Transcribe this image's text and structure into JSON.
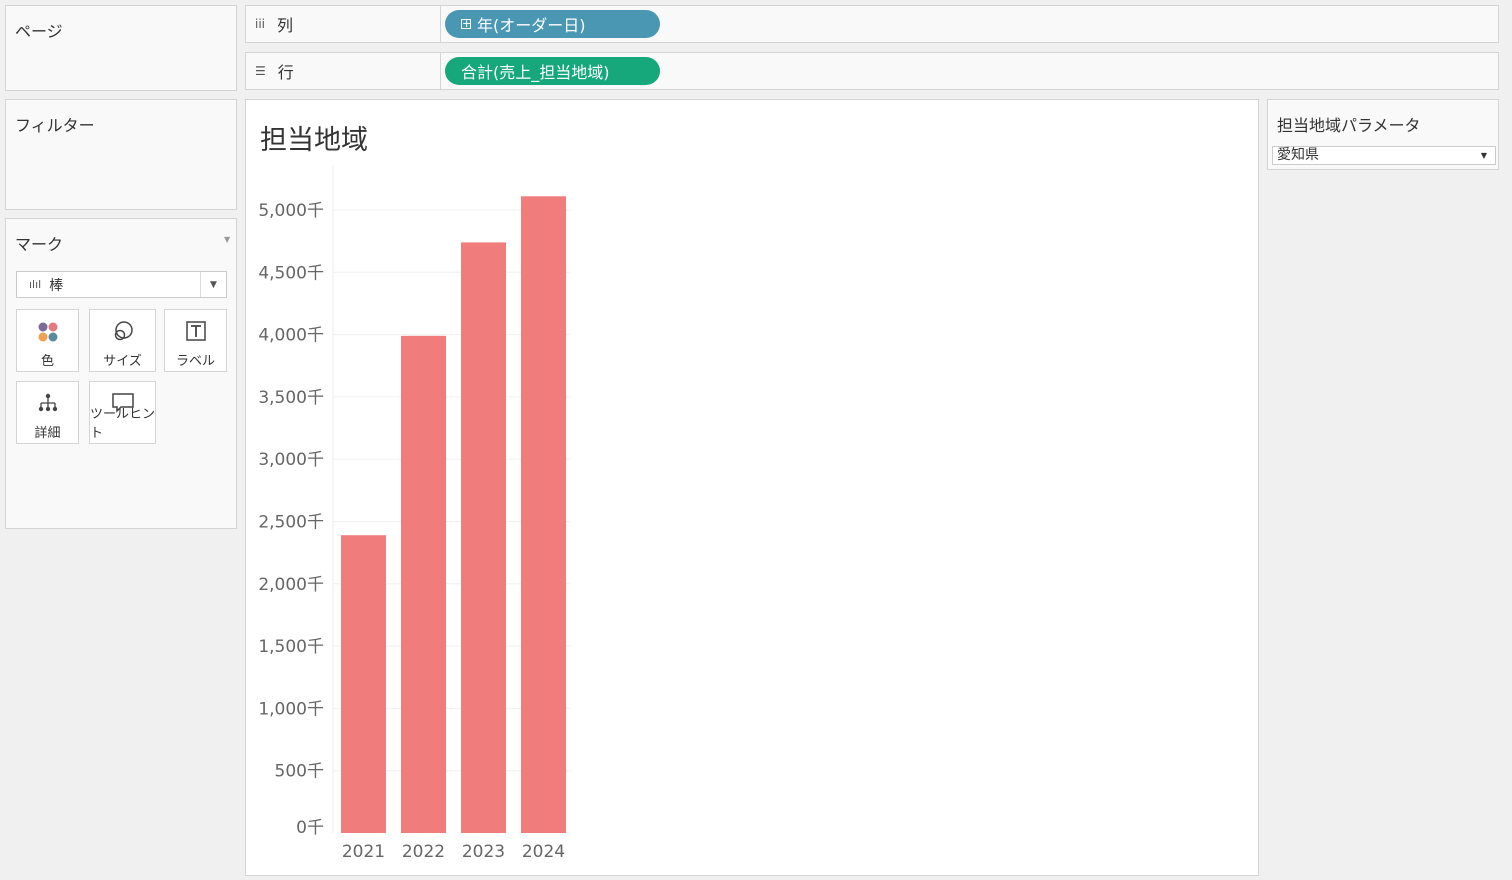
{
  "pages": {
    "title": "ページ"
  },
  "filters": {
    "title": "フィルター"
  },
  "marks": {
    "title": "マーク",
    "type_label": "棒",
    "buttons": [
      {
        "label": "色",
        "icon": "color-icon"
      },
      {
        "label": "サイズ",
        "icon": "size-icon"
      },
      {
        "label": "ラベル",
        "icon": "label-icon"
      },
      {
        "label": "詳細",
        "icon": "detail-icon"
      },
      {
        "label": "ツールヒント",
        "icon": "tooltip-icon"
      }
    ]
  },
  "shelves": {
    "columns": {
      "label": "列",
      "pill": "年(オーダー日)",
      "pill_color": "#4a97b4"
    },
    "rows": {
      "label": "行",
      "pill": "合計(売上_担当地域)",
      "pill_color": "#16a87a"
    }
  },
  "parameter": {
    "title": "担当地域パラメータ",
    "value": "愛知県"
  },
  "chart_data": {
    "type": "bar",
    "title": "担当地域",
    "categories": [
      "2021",
      "2022",
      "2023",
      "2024"
    ],
    "values": [
      2390,
      3990,
      4740,
      5110
    ],
    "y_ticks": [
      "0千",
      "500千",
      "1,000千",
      "1,500千",
      "2,000千",
      "2,500千",
      "3,000千",
      "3,500千",
      "4,000千",
      "4,500千",
      "5,000千"
    ],
    "ylim": [
      0,
      5200
    ],
    "bar_color": "#f07c7c",
    "grid": true
  }
}
